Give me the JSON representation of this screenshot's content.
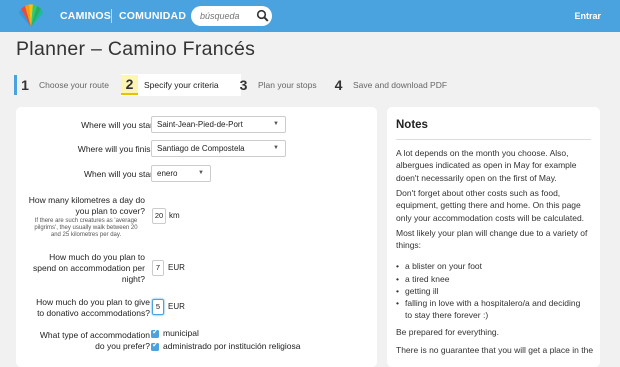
{
  "header": {
    "nav": [
      "CAMINOS",
      "COMUNIDAD"
    ],
    "search_placeholder": "búsqueda",
    "login": "Entrar",
    "logo_colors": [
      "#e74c3c",
      "#f39c12",
      "#f1c40f",
      "#2ecc71",
      "#27ae60",
      "#3498db"
    ]
  },
  "page": {
    "title": "Planner – Camino Francés"
  },
  "steps": [
    {
      "num": "1",
      "label": "Choose your route"
    },
    {
      "num": "2",
      "label": "Specify your criteria"
    },
    {
      "num": "3",
      "label": "Plan your stops"
    },
    {
      "num": "4",
      "label": "Save and download PDF"
    }
  ],
  "form": {
    "start_q": "Where will you start?",
    "start_val": "Saint-Jean-Pied-de-Port",
    "finish_q": "Where will you finish?",
    "finish_val": "Santiago de Compostela",
    "when_q": "When will you start?",
    "when_val": "enero",
    "km_q1": "How many kilometres a day do",
    "km_q2": "you plan to cover?",
    "km_note1": "If there are such creatures as 'average",
    "km_note2": "pilgrims', they usually walk between 20",
    "km_note3": "and 25 kilometres per day.",
    "km_val": "20",
    "km_unit": "km",
    "acc_q1": "How much do you plan to",
    "acc_q2": "spend on accommodation per",
    "acc_q3": "night?",
    "acc_val": "7",
    "acc_unit": "EUR",
    "don_q1": "How much do you plan to give",
    "don_q2": "to donativo accommodations?",
    "don_val": "5",
    "don_unit": "EUR",
    "type_q1": "What type of accommodation",
    "type_q2": "do you prefer?",
    "type_opts": [
      "municipal",
      "administrado por institución religiosa"
    ]
  },
  "notes": {
    "title": "Notes",
    "p1": [
      "A lot depends on the month you choose. Also,",
      "albergues indicated as open in May for example",
      "doen't necessarily open on the first of May."
    ],
    "p2": [
      "Don't forget about other costs such as food,",
      "equipment, getting there and home. On this page",
      "only your accommodation costs will be calculated."
    ],
    "p3": [
      "Most likely your plan will change due to a variety of",
      "things:"
    ],
    "items": [
      "a blister on your foot",
      "a tired knee",
      "getting ill",
      "falling in love with a hospitalero/a and deciding",
      "to stay there forever :)"
    ],
    "p4": "Be prepared for everything.",
    "p5": "There is no guarantee that you will get a place in the"
  }
}
